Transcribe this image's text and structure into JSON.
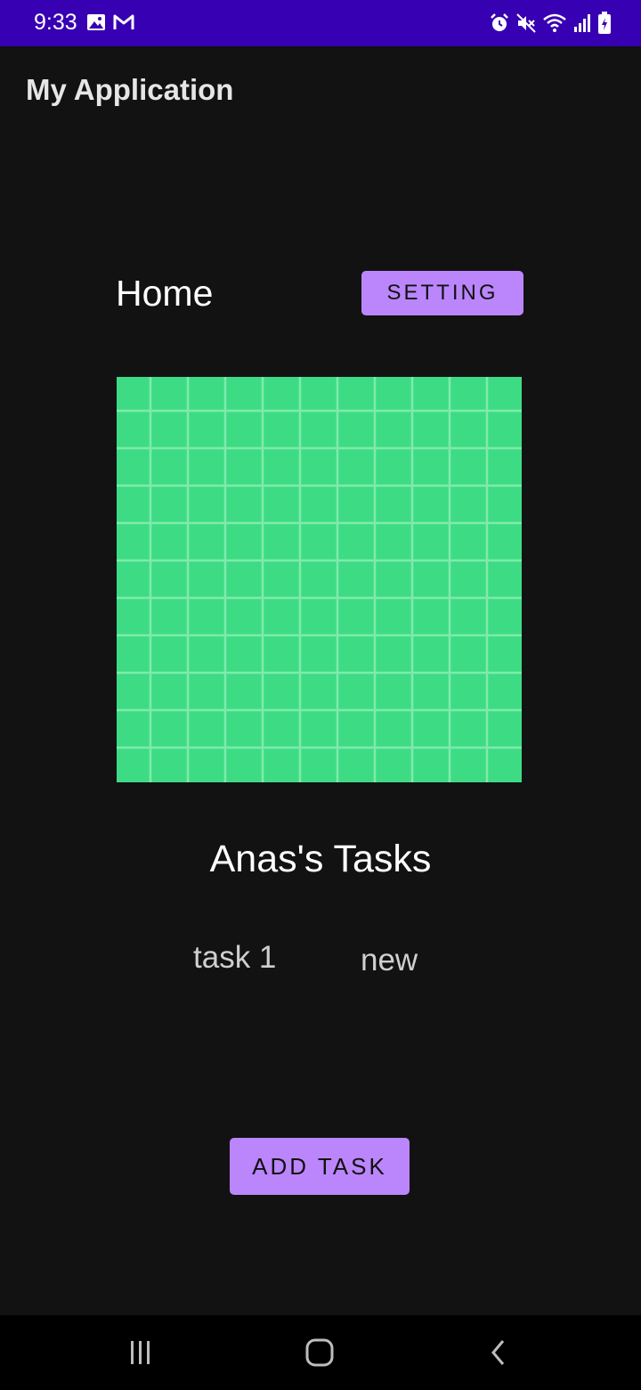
{
  "status_bar": {
    "time": "9:33",
    "left_icons": [
      "image-icon",
      "gmail-icon"
    ],
    "right_icons": [
      "alarm-icon",
      "mute-icon",
      "wifi-icon",
      "signal-icon",
      "battery-charging-icon"
    ],
    "background": "#3700B3"
  },
  "app_bar": {
    "title": "My Application"
  },
  "header": {
    "title": "Home",
    "setting_label": "SETTING"
  },
  "image": {
    "icon": "grid-image",
    "color": "#3DDC84"
  },
  "tasks": {
    "title": "Anas's Tasks",
    "items": [
      {
        "name": "task 1",
        "status": "new"
      }
    ]
  },
  "add_task_label": "ADD TASK",
  "nav_bar": {
    "items": [
      "recents-icon",
      "home-icon",
      "back-icon"
    ]
  },
  "colors": {
    "accent": "#BB86FC",
    "background": "#121212"
  }
}
